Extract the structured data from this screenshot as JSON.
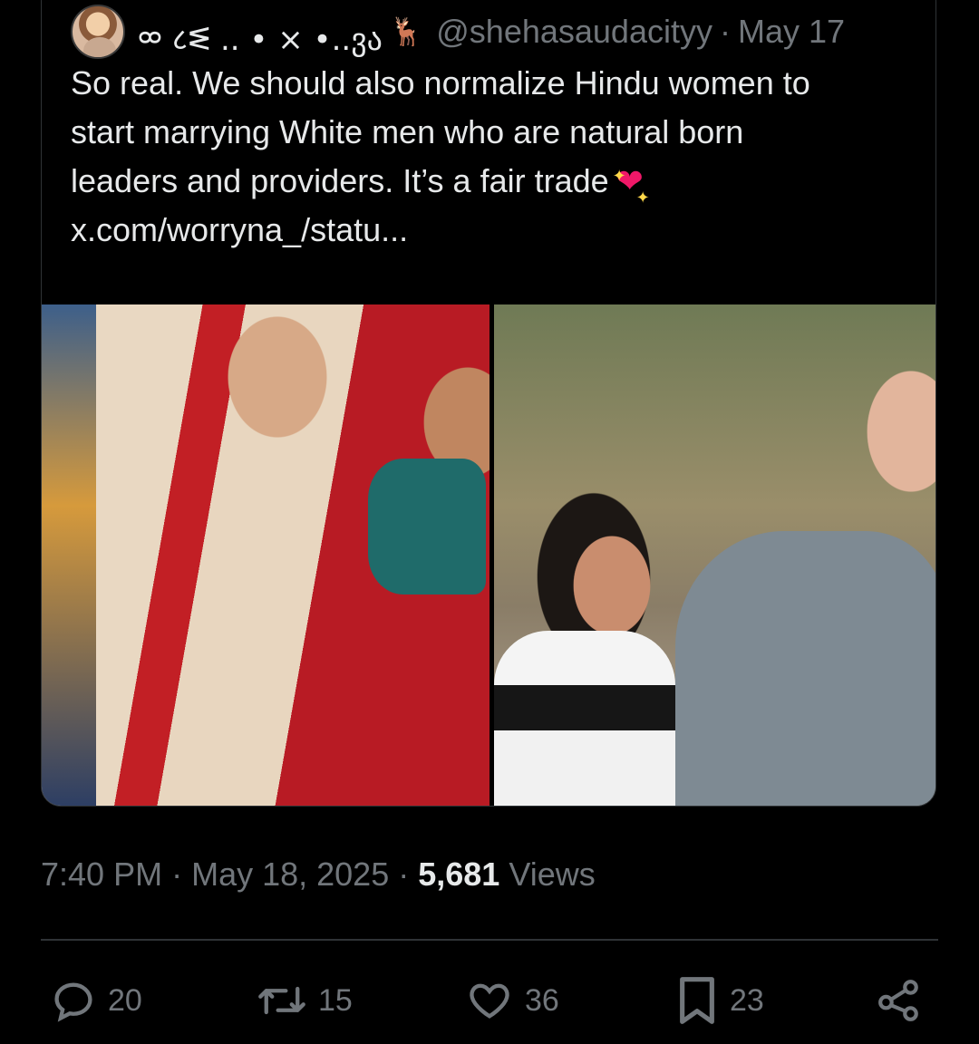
{
  "quote": {
    "display_name": "ᢁ ८ᓬ .. • × •..ვა",
    "handle": "@shehasaudacityy",
    "date": "May 17",
    "text_lines": [
      "So real. We should also normalize Hindu women to",
      "start marrying White men who are natural born",
      "leaders and providers. It’s a fair trade",
      "x.com/worryna_/statu..."
    ],
    "icons": {
      "avatar": "profile-photo",
      "deer": "deer-emoji",
      "heart": "sparkling-heart-emoji"
    },
    "media": [
      {
        "alt": "wedding-photo"
      },
      {
        "alt": "couple-photo"
      }
    ]
  },
  "meta": {
    "time": "7:40 PM",
    "date": "May 18, 2025",
    "views_count": "5,681",
    "views_label": "Views",
    "separator": "·"
  },
  "actions": {
    "reply_count": "20",
    "repost_count": "15",
    "like_count": "36",
    "bookmark_count": "23"
  },
  "colors": {
    "background": "#000000",
    "text_primary": "#e7e9ea",
    "text_secondary": "#71767b",
    "border": "#2f3336",
    "heart_emoji": "#f01868"
  }
}
